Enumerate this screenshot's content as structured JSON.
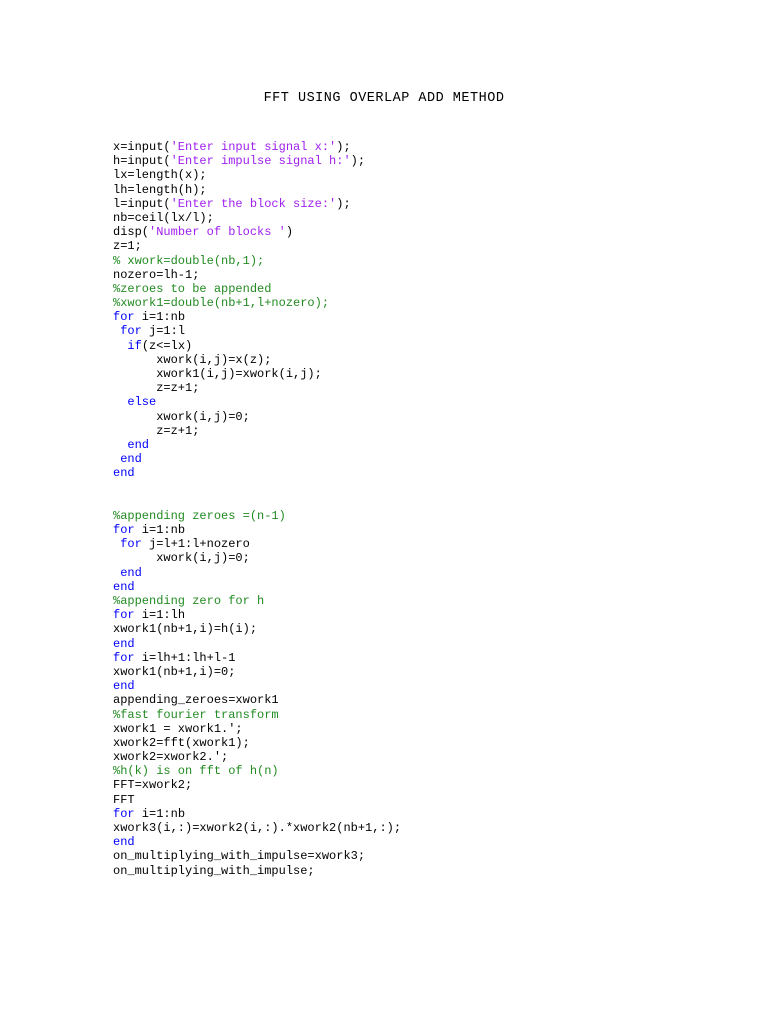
{
  "document": {
    "title": "FFT USING OVERLAP ADD METHOD"
  },
  "colors": {
    "code": "#000000",
    "string": "#a020f0",
    "keyword": "#0000ff",
    "comment": "#228b22"
  },
  "code_lines": [
    [
      [
        "x=input(",
        "code"
      ],
      [
        "'Enter input signal x:'",
        "str"
      ],
      [
        ");",
        "code"
      ]
    ],
    [
      [
        "h=input(",
        "code"
      ],
      [
        "'Enter impulse signal h:'",
        "str"
      ],
      [
        ");",
        "code"
      ]
    ],
    [
      [
        "lx=length(x);",
        "code"
      ]
    ],
    [
      [
        "lh=length(h);",
        "code"
      ]
    ],
    [
      [
        "l=input(",
        "code"
      ],
      [
        "'Enter the block size:'",
        "str"
      ],
      [
        ");",
        "code"
      ]
    ],
    [
      [
        "nb=ceil(lx/l);",
        "code"
      ]
    ],
    [
      [
        "disp(",
        "code"
      ],
      [
        "'Number of blocks '",
        "str"
      ],
      [
        ")",
        "code"
      ]
    ],
    [
      [
        "z=1;",
        "code"
      ]
    ],
    [
      [
        "% xwork=double(nb,1);",
        "cmt"
      ]
    ],
    [
      [
        "nozero=lh-1;",
        "code"
      ]
    ],
    [
      [
        "%zeroes to be appended",
        "cmt"
      ]
    ],
    [
      [
        "%xwork1=double(nb+1,l+nozero);",
        "cmt"
      ]
    ],
    [
      [
        "for",
        "kw"
      ],
      [
        " i=1:nb",
        "code"
      ]
    ],
    [
      [
        " ",
        "code"
      ],
      [
        "for",
        "kw"
      ],
      [
        " j=1:l",
        "code"
      ]
    ],
    [
      [
        "  ",
        "code"
      ],
      [
        "if",
        "kw"
      ],
      [
        "(z<=lx)",
        "code"
      ]
    ],
    [
      [
        "      xwork(i,j)=x(z);",
        "code"
      ]
    ],
    [
      [
        "      xwork1(i,j)=xwork(i,j);",
        "code"
      ]
    ],
    [
      [
        "      z=z+1;",
        "code"
      ]
    ],
    [
      [
        "  ",
        "code"
      ],
      [
        "else",
        "kw"
      ]
    ],
    [
      [
        "      xwork(i,j)=0;",
        "code"
      ]
    ],
    [
      [
        "      z=z+1;",
        "code"
      ]
    ],
    [
      [
        "  ",
        "code"
      ],
      [
        "end",
        "kw"
      ]
    ],
    [
      [
        " ",
        "code"
      ],
      [
        "end",
        "kw"
      ]
    ],
    [
      [
        "end",
        "kw"
      ]
    ],
    [],
    [],
    [
      [
        "%appending zeroes =(n-1)",
        "cmt"
      ]
    ],
    [
      [
        "for",
        "kw"
      ],
      [
        " i=1:nb",
        "code"
      ]
    ],
    [
      [
        " ",
        "code"
      ],
      [
        "for",
        "kw"
      ],
      [
        " j=l+1:l+nozero",
        "code"
      ]
    ],
    [
      [
        "      xwork(i,j)=0;",
        "code"
      ]
    ],
    [
      [
        " ",
        "code"
      ],
      [
        "end",
        "kw"
      ]
    ],
    [
      [
        "end",
        "kw"
      ]
    ],
    [
      [
        "%appending zero for h",
        "cmt"
      ]
    ],
    [
      [
        "for",
        "kw"
      ],
      [
        " i=1:lh",
        "code"
      ]
    ],
    [
      [
        "xwork1(nb+1,i)=h(i);",
        "code"
      ]
    ],
    [
      [
        "end",
        "kw"
      ]
    ],
    [
      [
        "for",
        "kw"
      ],
      [
        " i=lh+1:lh+l-1",
        "code"
      ]
    ],
    [
      [
        "xwork1(nb+1,i)=0;",
        "code"
      ]
    ],
    [
      [
        "end",
        "kw"
      ]
    ],
    [
      [
        "appending_zeroes=xwork1",
        "code"
      ]
    ],
    [
      [
        "%fast fourier transform",
        "cmt"
      ]
    ],
    [
      [
        "xwork1 = xwork1.';",
        "code"
      ]
    ],
    [
      [
        "xwork2=fft(xwork1);",
        "code"
      ]
    ],
    [
      [
        "xwork2=xwork2.';",
        "code"
      ]
    ],
    [
      [
        "%h(k) is on fft of h(n)",
        "cmt"
      ]
    ],
    [
      [
        "FFT=xwork2;",
        "code"
      ]
    ],
    [
      [
        "FFT",
        "code"
      ]
    ],
    [
      [
        "for",
        "kw"
      ],
      [
        " i=1:nb",
        "code"
      ]
    ],
    [
      [
        "xwork3(i,:)=xwork2(i,:).*xwork2(nb+1,:);",
        "code"
      ]
    ],
    [
      [
        "end",
        "kw"
      ]
    ],
    [
      [
        "on_multiplying_with_impulse=xwork3;",
        "code"
      ]
    ],
    [
      [
        "on_multiplying_with_impulse;",
        "code"
      ]
    ]
  ]
}
